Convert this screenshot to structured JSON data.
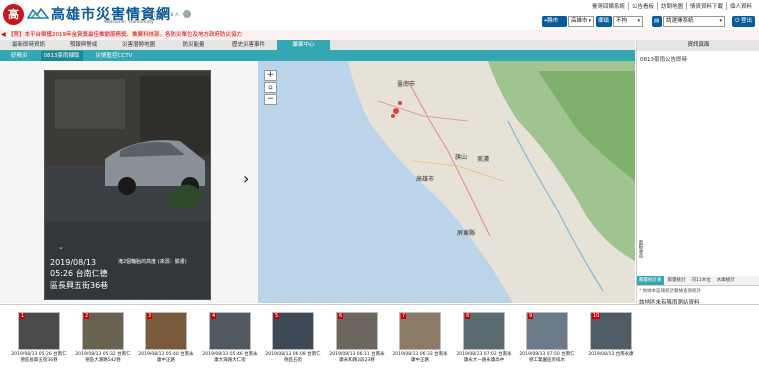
{
  "header": {
    "logo_badge_text": "高",
    "title": "高雄市災害情資網",
    "subtitle": "Welcome：HanInfinity",
    "online_count": "線上人數：8 人",
    "top_links": [
      "臺灣回饋系統",
      "公告看板",
      "訪問地圖",
      "情資資料下載",
      "個人資料"
    ],
    "city_label": "縣市",
    "city_value": "高雄市",
    "district_label": "鄉鎮",
    "district_value": "不拘",
    "system_value": "請選擇系統",
    "logout_label": "登出"
  },
  "marquee": {
    "text": "【賀】本平台榮獲2019年金賞獎最佳推動服務獎、推廣科技部。各防災單位及地方政府防災協力"
  },
  "tabs": [
    "最新即時資訊",
    "預報與警戒",
    "災害潛勢地圖",
    "防災能量",
    "歷史災害事件",
    "離聚中心"
  ],
  "active_tab": 5,
  "subtabs": [
    "好撥災",
    "0813豪雨擷取",
    "災情監控CCTV"
  ],
  "active_subtab": 1,
  "info_panel": {
    "title": "資訊頁面",
    "content": "0813豪雨公告即時",
    "side_toggle": "面板收合",
    "tabs": [
      "圖層統計表",
      "雨量統計",
      "司11水位",
      "水庫統計"
    ],
    "note": "* 依據本區域統計數據查詢統計",
    "no_data": "該地區未有降雨測站資料"
  },
  "photo": {
    "date": "2019/08/13",
    "time": "05:26 台南仁德",
    "location": "區長興五街36巷",
    "caption": "淹2個輪胎的高度 (來源：臉書)"
  },
  "map": {
    "cities": [
      "臺南市",
      "高雄市",
      "屏東縣",
      "旗山",
      "美濃"
    ]
  },
  "thumbnails": [
    {
      "num": "1",
      "caption": "2019/08/13 05:26 台南仁德區長興五街36巷",
      "color": "#4a4a4a"
    },
    {
      "num": "2",
      "caption": "2019/08/13 05:32 台南仁德區大潮路542巷",
      "color": "#6a6250"
    },
    {
      "num": "3",
      "caption": "2019/08/13 05:40 台南永康中正路",
      "color": "#7a5a3a"
    },
    {
      "num": "4",
      "caption": "2019/08/13 05:46 台南永康大灣路大仁街",
      "color": "#505a60"
    },
    {
      "num": "5",
      "caption": "2019/08/13 06:08 台南仁德區五街",
      "color": "#3d4a55"
    },
    {
      "num": "6",
      "caption": "2019/08/13 06:11 台南永康永和路2段23巷",
      "color": "#6c665e"
    },
    {
      "num": "7",
      "caption": "2019/08/13 06:33 台南永康中正路",
      "color": "#8a7a66"
    },
    {
      "num": "8",
      "caption": "2019/08/13 07:02 台南永康永大一路永康高中",
      "color": "#5a6a70"
    },
    {
      "num": "9",
      "caption": "2019/08/13 07:50 台南仁德工業園區旁排水",
      "color": "#6b7a88"
    },
    {
      "num": "10",
      "caption": "2019/08/13 台南永康",
      "color": "#4f5c66"
    }
  ]
}
